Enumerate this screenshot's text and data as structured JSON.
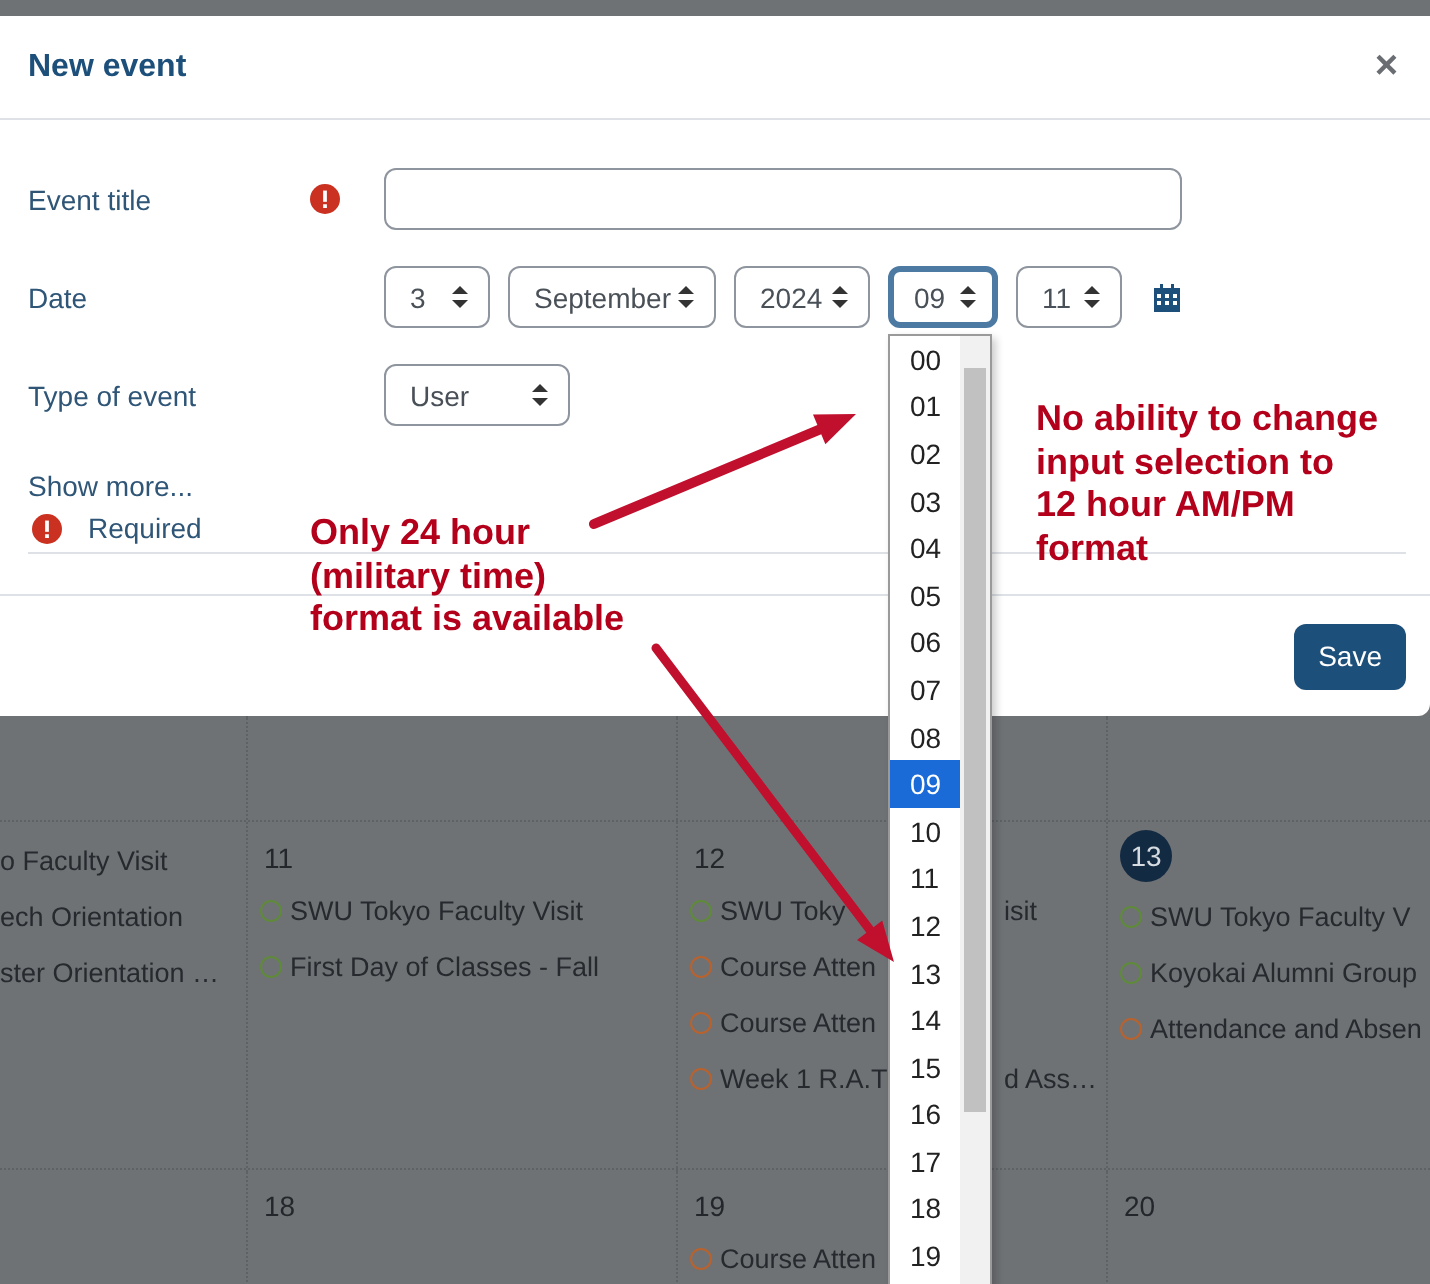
{
  "dialog": {
    "title": "New event",
    "close_symbol": "×",
    "event_title": {
      "label": "Event title",
      "required": true
    },
    "date": {
      "label": "Date",
      "selects": [
        {
          "value": "3",
          "focused": false
        },
        {
          "value": "September",
          "focused": false
        },
        {
          "value": "2024",
          "focused": false
        },
        {
          "value": "09",
          "focused": true
        },
        {
          "value": "11",
          "focused": false
        }
      ]
    },
    "type_of_event": {
      "label": "Type of event",
      "value": "User"
    },
    "show_more": "Show more...",
    "required_note": "Required",
    "save": "Save"
  },
  "hour_dropdown": {
    "options": [
      {
        "label": "00",
        "selected": false
      },
      {
        "label": "01",
        "selected": false
      },
      {
        "label": "02",
        "selected": false
      },
      {
        "label": "03",
        "selected": false
      },
      {
        "label": "04",
        "selected": false
      },
      {
        "label": "05",
        "selected": false
      },
      {
        "label": "06",
        "selected": false
      },
      {
        "label": "07",
        "selected": false
      },
      {
        "label": "08",
        "selected": false
      },
      {
        "label": "09",
        "selected": true
      },
      {
        "label": "10",
        "selected": false
      },
      {
        "label": "11",
        "selected": false
      },
      {
        "label": "12",
        "selected": false
      },
      {
        "label": "13",
        "selected": false
      },
      {
        "label": "14",
        "selected": false
      },
      {
        "label": "15",
        "selected": false
      },
      {
        "label": "16",
        "selected": false
      },
      {
        "label": "17",
        "selected": false
      },
      {
        "label": "18",
        "selected": false
      },
      {
        "label": "19",
        "selected": false
      }
    ]
  },
  "calendar": {
    "weeks": [
      {
        "days": [
          {
            "kind": "empty"
          },
          {
            "kind": "empty"
          },
          {
            "kind": "empty"
          },
          {
            "kind": "empty"
          }
        ]
      },
      {
        "days": [
          {
            "kind": "day",
            "events": [
              {
                "text": "o Faculty Visit"
              },
              {
                "text": "ech Orientation"
              },
              {
                "text": "ster Orientation …"
              }
            ]
          },
          {
            "kind": "day",
            "day": "11",
            "today": false,
            "events": [
              {
                "text": "SWU Tokyo Faculty Visit",
                "color": "#5f8a3a"
              },
              {
                "text": "First Day of Classes - Fall",
                "color": "#5f8a3a"
              }
            ]
          },
          {
            "kind": "day",
            "day": "12",
            "today": false,
            "events": [
              {
                "text": "SWU Toky",
                "tail": "isit",
                "color": "#5f8a3a"
              },
              {
                "text": "Course Atten",
                "color": "#b8622e"
              },
              {
                "text": "Course Atten",
                "color": "#b8622e"
              },
              {
                "text": "Week 1 R.A.T",
                "tail": "d Ass…",
                "color": "#b8622e"
              }
            ]
          },
          {
            "kind": "day",
            "day": "13",
            "today": true,
            "events": [
              {
                "text": "SWU Tokyo Faculty V",
                "color": "#5f8a3a"
              },
              {
                "text": "Koyokai Alumni Group",
                "color": "#5f8a3a"
              },
              {
                "text": "Attendance and Absen",
                "color": "#b8622e"
              }
            ]
          }
        ]
      },
      {
        "days": [
          {
            "kind": "empty"
          },
          {
            "kind": "day",
            "day": "18",
            "today": false
          },
          {
            "kind": "day",
            "day": "19",
            "today": false,
            "events": [
              {
                "text": "Course Atten",
                "color": "#b8622e"
              }
            ]
          },
          {
            "kind": "day",
            "day": "20",
            "today": false
          }
        ]
      }
    ]
  },
  "annotations": [
    {
      "text": "No ability to change\ninput selection to\n12 hour AM/PM\nformat"
    },
    {
      "text": "Only 24 hour\n(military time)\nformat is available"
    }
  ]
}
